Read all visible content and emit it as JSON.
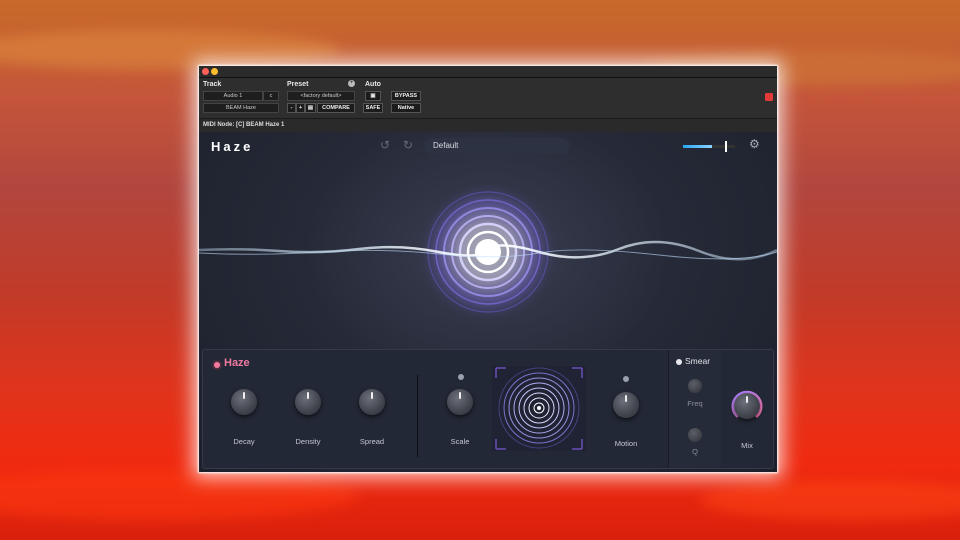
{
  "host": {
    "track_label": "Track",
    "track_name": "Audio 1",
    "track_channel": "c",
    "track_insert": "BEAM Haze",
    "preset_label": "Preset",
    "preset_value": "<factory default>",
    "compare_label": "COMPARE",
    "auto_label": "Auto",
    "safe_label": "SAFE",
    "bypass_label": "BYPASS",
    "native_label": "Native",
    "midi_node": "MIDI Node: [C] BEAM Haze 1"
  },
  "plugin": {
    "title": "Haze",
    "preset_name": "Default",
    "icons": [
      "undo-icon",
      "redo-icon",
      "gear-icon"
    ],
    "output_level": 0.55
  },
  "controls": {
    "section_title": "Haze",
    "knobs": [
      {
        "label": "Decay"
      },
      {
        "label": "Density"
      },
      {
        "label": "Spread"
      },
      {
        "label": "Scale"
      },
      {
        "label": "Motion"
      }
    ],
    "smear": {
      "title": "Smear",
      "freq_label": "Freq",
      "q_label": "Q"
    },
    "mix_label": "Mix"
  },
  "colors": {
    "accent_pink": "#f07aa0",
    "section_led": "#e04050",
    "meter_blue": "#2aa6f0",
    "glow": "#c8c0ff"
  }
}
